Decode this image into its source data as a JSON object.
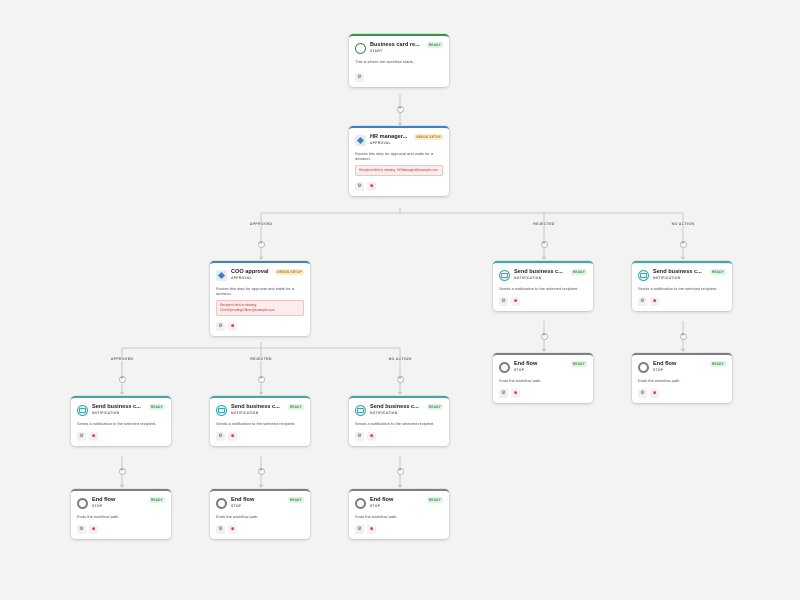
{
  "steps": {
    "start": {
      "title": "Business card re...",
      "type": "START",
      "status": "READY",
      "description": "This is where the workflow starts.",
      "icon": "circle-start-icon"
    },
    "hr": {
      "title": "HR manager...",
      "type": "APPROVAL",
      "status": "NEEDS SETUP",
      "description": "Routes this step for approval and waits for a decision.",
      "warning": "Recipient field is missing: HRManager@example.com",
      "icon": "approval-diamond-icon"
    },
    "coo": {
      "title": "COO approval",
      "type": "APPROVAL",
      "status": "NEEDS SETUP",
      "description": "Routes this step for approval and waits for a decision.",
      "warning": "Recipient field is missing: ChiefOperatingOfficer@example.com",
      "icon": "approval-diamond-icon"
    },
    "notify_hr_rejected": {
      "title": "Send business c...",
      "type": "NOTIFICATION",
      "status": "READY",
      "description": "Sends a notification to the selected recipient.",
      "icon": "notification-icon"
    },
    "notify_hr_noaction": {
      "title": "Send business c...",
      "type": "NOTIFICATION",
      "status": "READY",
      "description": "Sends a notification to the selected recipient.",
      "icon": "notification-icon"
    },
    "end_hr_rejected": {
      "title": "End flow",
      "type": "STOP",
      "status": "READY",
      "description": "Ends the workflow path.",
      "icon": "end-flow-icon"
    },
    "end_hr_noaction": {
      "title": "End flow",
      "type": "STOP",
      "status": "READY",
      "description": "Ends the workflow path.",
      "icon": "end-flow-icon"
    },
    "notify_coo_approved": {
      "title": "Send business c...",
      "type": "NOTIFICATION",
      "status": "READY",
      "description": "Sends a notification to the selected recipient.",
      "icon": "notification-icon"
    },
    "notify_coo_rejected": {
      "title": "Send business c...",
      "type": "NOTIFICATION",
      "status": "READY",
      "description": "Sends a notification to the selected recipient.",
      "icon": "notification-icon"
    },
    "notify_coo_noaction": {
      "title": "Send business c...",
      "type": "NOTIFICATION",
      "status": "READY",
      "description": "Sends a notification to the selected recipient.",
      "icon": "notification-icon"
    },
    "end_coo_approved": {
      "title": "End flow",
      "type": "STOP",
      "status": "READY",
      "description": "Ends the workflow path.",
      "icon": "end-flow-icon"
    },
    "end_coo_rejected": {
      "title": "End flow",
      "type": "STOP",
      "status": "READY",
      "description": "Ends the workflow path.",
      "icon": "end-flow-icon"
    },
    "end_coo_noaction": {
      "title": "End flow",
      "type": "STOP",
      "status": "READY",
      "description": "Ends the workflow path.",
      "icon": "end-flow-icon"
    }
  },
  "branch_labels": {
    "hr_approved": "APPROVED",
    "hr_rejected": "REJECTED",
    "hr_noaction": "NO ACTION",
    "coo_approved": "APPROVED",
    "coo_rejected": "REJECTED",
    "coo_noaction": "NO ACTION"
  },
  "add_step_symbol": "+",
  "action_icons": {
    "settings": "gear-icon",
    "delete": "trash-icon"
  },
  "colors": {
    "background": "#f3f4f2",
    "start_accent": "#2e9a49",
    "approval_accent": "#3f7fc6",
    "notification_accent": "#3aa8b0",
    "end_accent": "#7c7f86",
    "ready_badge": "#2e8b45",
    "setup_badge": "#b46e0c",
    "warning": "#c0393b",
    "connector": "#b9bcb9"
  }
}
